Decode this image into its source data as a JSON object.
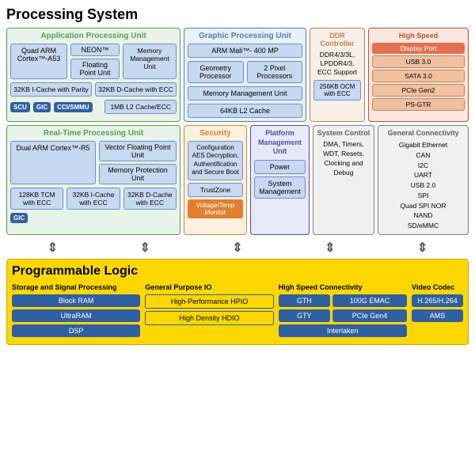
{
  "title": "Processing System",
  "apu": {
    "title": "Application Processing Unit",
    "cortex": "Quad ARM Cortex™-A53",
    "neon": "NEON™",
    "fpu": "Floating Point Unit",
    "mmu": "Memory Management Unit",
    "icache": "32KB I-Cache with Parity",
    "dcache": "32KB D-Cache with ECC",
    "scu": "SCU",
    "gic": "GIC",
    "cciSmmu": "CCI/SMMU",
    "l2": "1MB L2 Cache/ECC"
  },
  "gpu": {
    "title": "Graphic Processing Unit",
    "mali": "ARM Mali™- 400 MP",
    "geometry": "Geometry Processor",
    "pixel": "2 Pixel Processors",
    "mmu": "Memory Management Unit",
    "l2": "64KB L2 Cache"
  },
  "ddr": {
    "title": "DDR Controller",
    "content": "DDR4/3/3L, LPDDR4/3, ECC Support",
    "ocm": "256KB OCM with ECC"
  },
  "hs": {
    "title": "High Speed",
    "dp": "Display Port",
    "usb": "USB 3.0",
    "sata": "SATA 3.0",
    "pcie": "PCIe Gen2",
    "psgtr": "PS-GTR"
  },
  "rpu": {
    "title": "Real-Time Processing Unit",
    "cortex": "Dual ARM Cortex™-R5",
    "vfpu": "Vector Floating Point Unit",
    "mpu": "Memory Protection Unit",
    "tcm": "128KB TCM with ECC",
    "icache": "32KB I-Cache with ECC",
    "dcache": "32KB D-Cache with ECC",
    "gic": "GIC"
  },
  "security": {
    "title": "Security",
    "aes": "Configuration AES Decryption, Authentification and Secure Boot",
    "trustzone": "TrustZone",
    "volttemp": "Voltage/Temp Monitor"
  },
  "pmu": {
    "title": "Platform Management Unit",
    "power": "Power",
    "sysmgmt": "System Management"
  },
  "sysctrl": {
    "title": "System Control",
    "content": "DMA, Timers, WDT, Resets, Clocking and Debug"
  },
  "genconn": {
    "title": "General Connectivity",
    "items": [
      "Gigabit Ethernet",
      "CAN",
      "I2C",
      "UART",
      "USB 2.0",
      "SPI",
      "Quad SPI NOR",
      "NAND",
      "SD/eMMC"
    ]
  },
  "pl": {
    "title": "Programmable Logic",
    "storage": {
      "title": "Storage and Signal Processing",
      "items": [
        "Block RAM",
        "UltraRAM",
        "DSP"
      ]
    },
    "gpio": {
      "title": "General Purpose IO",
      "items": [
        "High-Performance HPIO",
        "High Density HDIO"
      ]
    },
    "hsconn": {
      "title": "High Speed Connectivity",
      "items": [
        "GTH",
        "100G EMAC",
        "GTY",
        "PCIe Gen4",
        "Interlaken"
      ]
    },
    "video": {
      "title": "Video Codec",
      "items": [
        "H.265/H.264",
        "AMS"
      ]
    }
  }
}
